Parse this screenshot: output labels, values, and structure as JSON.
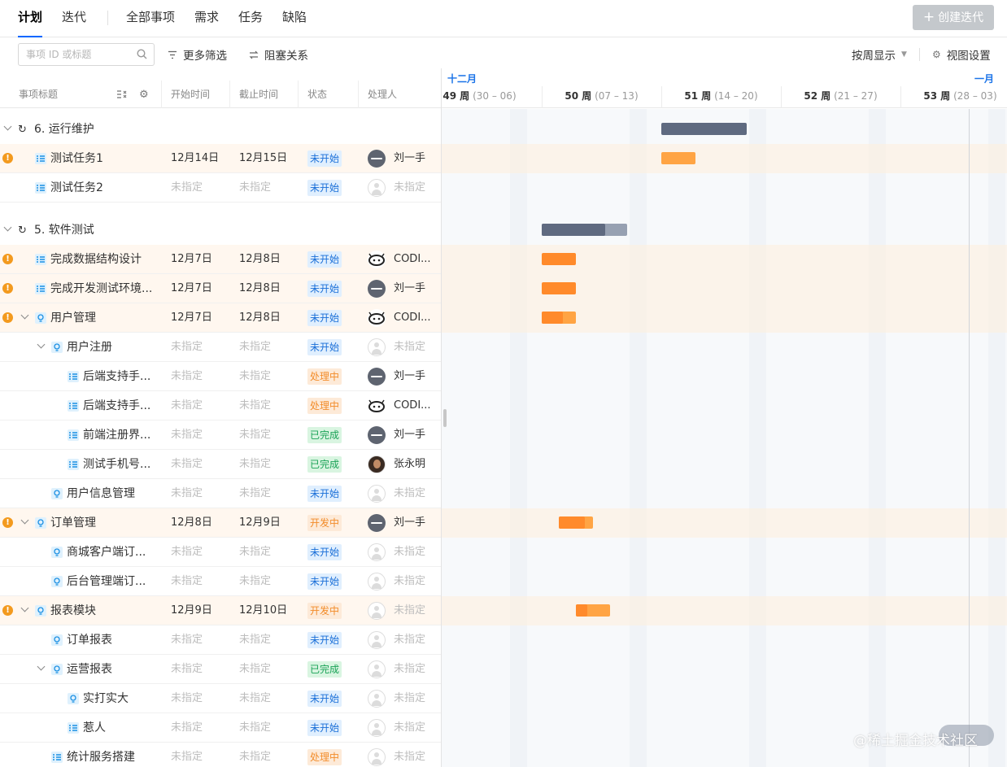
{
  "nav": {
    "tabs": [
      {
        "label": "计划",
        "active": true
      },
      {
        "label": "迭代"
      },
      {
        "label": "全部事项"
      },
      {
        "label": "需求"
      },
      {
        "label": "任务"
      },
      {
        "label": "缺陷"
      }
    ],
    "create_button": "创建迭代"
  },
  "toolbar": {
    "search_placeholder": "事项 ID 或标题",
    "more_filter": "更多筛选",
    "block_relation": "阻塞关系",
    "week_display": "按周显示",
    "view_settings": "视图设置"
  },
  "columns": {
    "title": "事项标题",
    "start": "开始时间",
    "end": "截止时间",
    "status": "状态",
    "assignee": "处理人"
  },
  "timeline": {
    "months": [
      "十二月",
      "一月"
    ],
    "weeks": [
      {
        "label": "49 周",
        "range": "(30 – 06)"
      },
      {
        "label": "50 周",
        "range": "(07 – 13)"
      },
      {
        "label": "51 周",
        "range": "(14 – 20)"
      },
      {
        "label": "52 周",
        "range": "(21 – 27)"
      },
      {
        "label": "53 周",
        "range": "(28 – 03)"
      }
    ]
  },
  "groups": [
    {
      "title": "6. 运行维护"
    },
    {
      "title": "5. 软件测试"
    }
  ],
  "rows": [
    {
      "title": "测试任务1",
      "start": "12月14日",
      "end": "12月15日",
      "status": "未开始",
      "assignee": "刘一手"
    },
    {
      "title": "测试任务2",
      "start": "未指定",
      "end": "未指定",
      "status": "未开始",
      "assignee": "未指定"
    },
    {
      "title": "完成数据结构设计",
      "start": "12月7日",
      "end": "12月8日",
      "status": "未开始",
      "assignee": "CODI..."
    },
    {
      "title": "完成开发测试环境...",
      "start": "12月7日",
      "end": "12月8日",
      "status": "未开始",
      "assignee": "刘一手"
    },
    {
      "title": "用户管理",
      "start": "12月7日",
      "end": "12月8日",
      "status": "未开始",
      "assignee": "CODI..."
    },
    {
      "title": "用户注册",
      "start": "未指定",
      "end": "未指定",
      "status": "未开始",
      "assignee": "未指定"
    },
    {
      "title": "后端支持手...",
      "start": "未指定",
      "end": "未指定",
      "status": "处理中",
      "assignee": "刘一手"
    },
    {
      "title": "后端支持手...",
      "start": "未指定",
      "end": "未指定",
      "status": "处理中",
      "assignee": "CODI..."
    },
    {
      "title": "前端注册界...",
      "start": "未指定",
      "end": "未指定",
      "status": "已完成",
      "assignee": "刘一手"
    },
    {
      "title": "测试手机号...",
      "start": "未指定",
      "end": "未指定",
      "status": "已完成",
      "assignee": "张永明"
    },
    {
      "title": "用户信息管理",
      "start": "未指定",
      "end": "未指定",
      "status": "未开始",
      "assignee": "未指定"
    },
    {
      "title": "订单管理",
      "start": "12月8日",
      "end": "12月9日",
      "status": "开发中",
      "assignee": "刘一手"
    },
    {
      "title": "商城客户端订...",
      "start": "未指定",
      "end": "未指定",
      "status": "未开始",
      "assignee": "未指定"
    },
    {
      "title": "后台管理端订...",
      "start": "未指定",
      "end": "未指定",
      "status": "未开始",
      "assignee": "未指定"
    },
    {
      "title": "报表模块",
      "start": "12月9日",
      "end": "12月10日",
      "status": "开发中",
      "assignee": "未指定"
    },
    {
      "title": "订单报表",
      "start": "未指定",
      "end": "未指定",
      "status": "未开始",
      "assignee": "未指定"
    },
    {
      "title": "运营报表",
      "start": "未指定",
      "end": "未指定",
      "status": "已完成",
      "assignee": "未指定"
    },
    {
      "title": "实打实大",
      "start": "未指定",
      "end": "未指定",
      "status": "未开始",
      "assignee": "未指定"
    },
    {
      "title": "惹人",
      "start": "未指定",
      "end": "未指定",
      "status": "未开始",
      "assignee": "未指定"
    },
    {
      "title": "统计服务搭建",
      "start": "未指定",
      "end": "未指定",
      "status": "处理中",
      "assignee": "未指定"
    }
  ],
  "watermark": "@稀土掘金技术社区",
  "colors": {
    "accent": "#0066ff",
    "status_todo": "#1a6fd8",
    "status_doing": "#f28c2a",
    "status_done": "#1aa257",
    "warning": "#f39a1e",
    "bar_group": "#5f6a80",
    "bar_task": "#ff8a2b"
  }
}
